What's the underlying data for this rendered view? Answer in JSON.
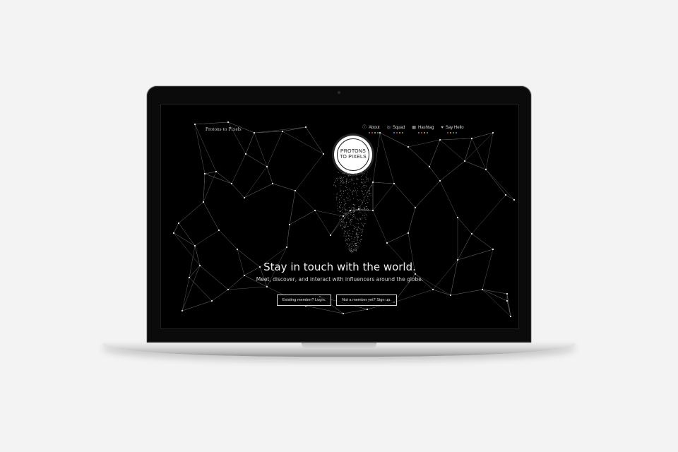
{
  "site": {
    "brand": "Protons to Pixels",
    "logo_lines": [
      "PROTONS",
      "TO PIXELS"
    ],
    "nav": [
      {
        "label": "About",
        "icon": "info-icon",
        "glyph": "ⓘ",
        "dots": [
          "#8a8a8a",
          "#d24b4b",
          "#e0b63c",
          "#5fa85f"
        ]
      },
      {
        "label": "Squad",
        "icon": "eye-icon",
        "glyph": "◎",
        "dots": [
          "#4e8ed6",
          "#d24b4b",
          "#e0b63c",
          "#5fa85f"
        ]
      },
      {
        "label": "Hashtag",
        "icon": "hashtag-icon",
        "glyph": "▦",
        "dots": [
          "#8a8a8a",
          "#d24b4b",
          "#e0b63c",
          "#5fa85f"
        ]
      },
      {
        "label": "Say Hello",
        "icon": "heart-icon",
        "glyph": "♥",
        "dots": [
          "#d24b4b",
          "#e0b63c",
          "#5fa85f",
          "#4e8ed6"
        ]
      }
    ],
    "headline": "Stay in touch with the world.",
    "subline": "Meet, discover, and interact with influencers around the globe.",
    "login_label": "Existing member? Login.",
    "signup_label": "Not a member yet? Sign up."
  },
  "colors": {
    "screen_bg": "#000000",
    "network_line": "#5a5a5a",
    "network_node": "#e6e6e6"
  }
}
